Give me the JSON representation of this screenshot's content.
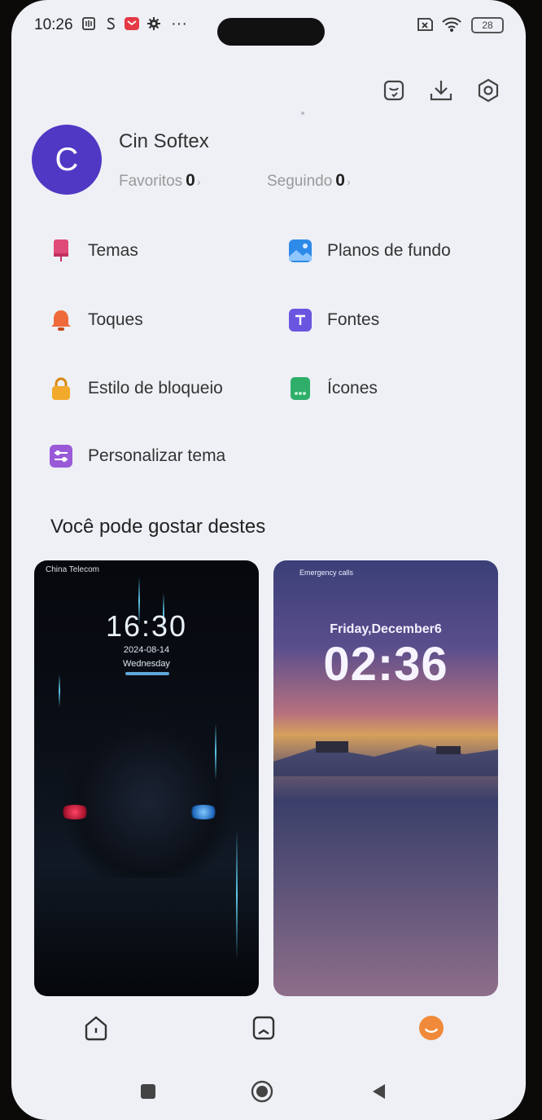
{
  "status_bar": {
    "time": "10:26",
    "dots": "···",
    "battery": "28"
  },
  "profile": {
    "avatar_letter": "C",
    "name": "Cin Softex",
    "favorites_label": "Favoritos",
    "favorites_count": "0",
    "following_label": "Seguindo",
    "following_count": "0"
  },
  "menu": [
    {
      "label": "Temas",
      "icon": "theme-icon",
      "color": "#e04a78"
    },
    {
      "label": "Planos de fundo",
      "icon": "wallpaper-icon",
      "color": "#2e8ae8"
    },
    {
      "label": "Toques",
      "icon": "bell-icon",
      "color": "#ef6a3a"
    },
    {
      "label": "Fontes",
      "icon": "font-icon",
      "color": "#6a55e0"
    },
    {
      "label": "Estilo de bloqueio",
      "icon": "lock-icon",
      "color": "#f2a92c"
    },
    {
      "label": "Ícones",
      "icon": "apps-icon",
      "color": "#2fae6a"
    },
    {
      "label": "Personalizar tema",
      "icon": "sliders-icon",
      "color": "#9a5ad8"
    }
  ],
  "section": {
    "title": "Você pode gostar destes"
  },
  "cards": [
    {
      "carrier": "China Telecom",
      "time": "16:30",
      "date": "2024-08-14",
      "day": "Wednesday"
    },
    {
      "carrier": "Emergency calls",
      "date": "Friday,December6",
      "time": "02:36"
    }
  ],
  "colors": {
    "screen_bg": "#eef0f5",
    "accent": "#5038c4",
    "nav_accent": "#f08a3a"
  }
}
